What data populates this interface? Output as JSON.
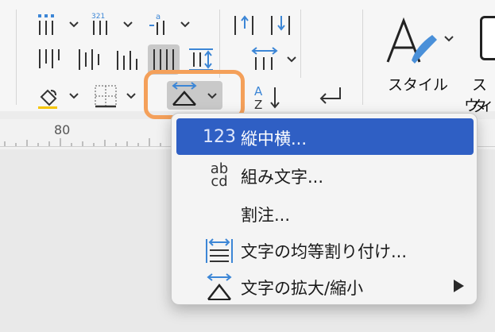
{
  "ribbon": {
    "style_label": "スタイル",
    "style_pane_label_line1": "スタ",
    "style_pane_label_line2": "ウィ"
  },
  "ruler": {
    "mark": "80"
  },
  "menu": {
    "items": [
      {
        "label": "縦中横...",
        "icon_text": "123",
        "icon": "tate-chu-yoko-icon",
        "active": true
      },
      {
        "label": "組み文字...",
        "icon_text": "ab\ncd",
        "icon": "kumimoji-icon",
        "active": false
      },
      {
        "label": "割注...",
        "icon_text": "",
        "icon": "",
        "active": false
      },
      {
        "label": "文字の均等割り付け...",
        "icon_text": "",
        "icon": "distribute-text-icon",
        "active": false
      },
      {
        "label": "文字の拡大/縮小",
        "icon_text": "",
        "icon": "character-scale-icon",
        "active": false,
        "has_submenu": true
      }
    ]
  },
  "colors": {
    "accent": "#2f5fc4",
    "highlight_ring": "#f4a05a",
    "icon_blue": "#3c86d6"
  }
}
